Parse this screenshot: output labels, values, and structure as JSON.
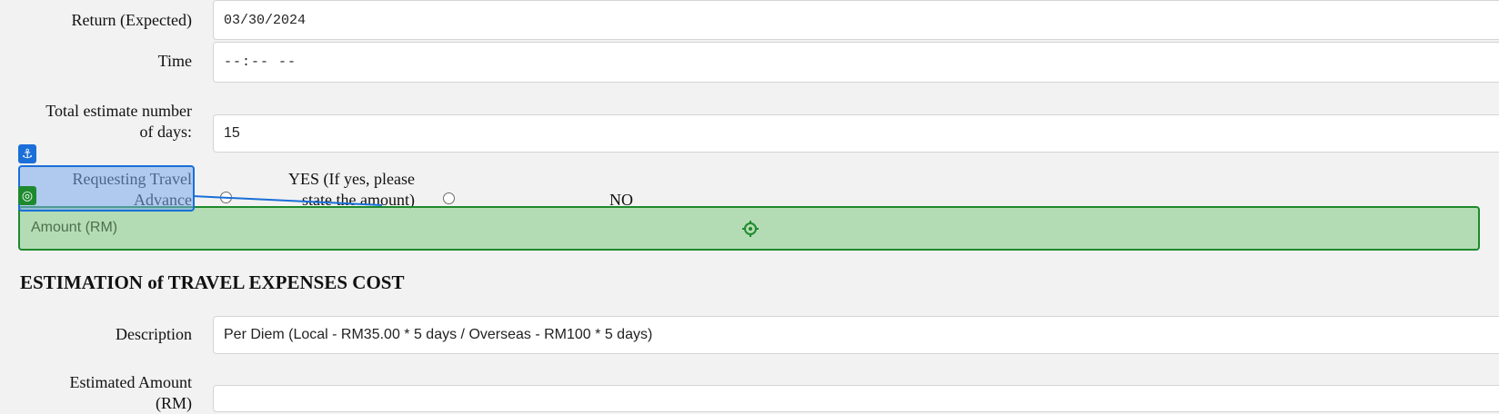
{
  "form": {
    "return_label": "Return (Expected)",
    "return_value": "03/30/2024",
    "time_label": "Time",
    "time_value": "--:-- --",
    "days_label_line1": "Total estimate number",
    "days_label_line2": "of days:",
    "days_value": "15",
    "advance_label_line1": "Requesting Travel",
    "advance_label_line2": "Advance",
    "yes_line1": "YES (If yes, please",
    "yes_line2": "state the amount)",
    "no_label": "NO",
    "amount_placeholder": "Amount (RM)"
  },
  "section": {
    "heading": "ESTIMATION of TRAVEL EXPENSES COST",
    "description_label": "Description",
    "description_value": "Per Diem (Local - RM35.00 * 5 days / Overseas - RM100 * 5 days)",
    "estimated_label_line1": "Estimated Amount",
    "estimated_label_line2": "(RM)"
  },
  "overlay": {
    "anchor_icon": "anchor-icon",
    "target_icon": "target-icon",
    "crosshair_icon": "crosshair-icon",
    "anchor_color": "#1a6fd8",
    "target_color": "#1e8a2e"
  }
}
